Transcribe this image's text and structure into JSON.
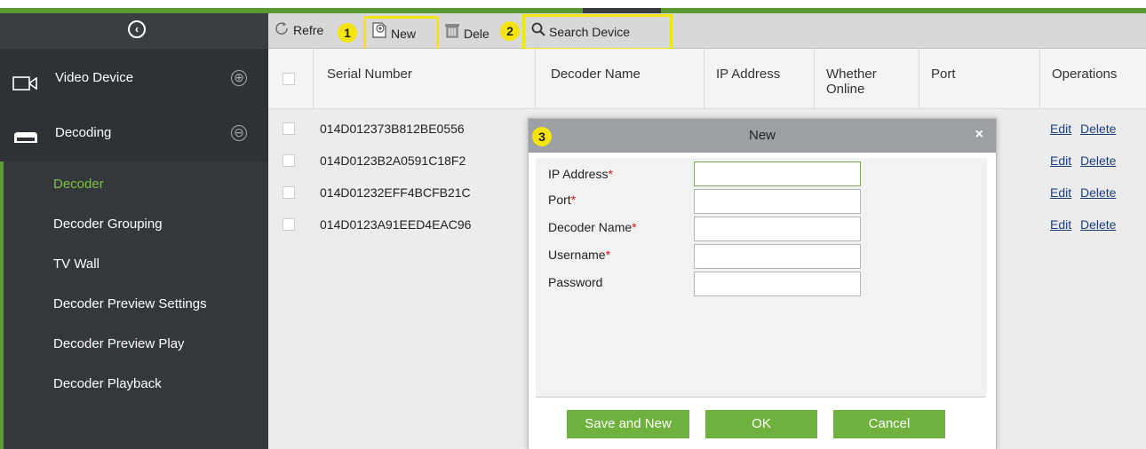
{
  "sidebar": {
    "collapse_icon": "chevron-left-circle-icon",
    "groups": [
      {
        "label": "Video Device",
        "icon": "camera-icon",
        "toggle": "⊕"
      },
      {
        "label": "Decoding",
        "icon": "decoder-device-icon",
        "toggle": "⊖"
      }
    ],
    "items": [
      {
        "label": "Decoder",
        "active": true
      },
      {
        "label": "Decoder Grouping"
      },
      {
        "label": "TV Wall"
      },
      {
        "label": "Decoder Preview Settings"
      },
      {
        "label": "Decoder Preview Play"
      },
      {
        "label": "Decoder Playback"
      }
    ]
  },
  "toolbar": {
    "refresh_label": "Refre",
    "new_label": "New",
    "delete_label": "Dele",
    "search_label": "Search Device"
  },
  "callouts": [
    "1",
    "2",
    "3"
  ],
  "table": {
    "columns": [
      "Serial Number",
      "Decoder Name",
      "IP Address",
      "Whether Online",
      "Port",
      "Operations"
    ],
    "rows": [
      {
        "serial": "014D012373B812BE0556",
        "edit": "Edit",
        "delete": "Delete"
      },
      {
        "serial": "014D0123B2A0591C18F2",
        "edit": "Edit",
        "delete": "Delete"
      },
      {
        "serial": "014D01232EFF4BCFB21C",
        "edit": "Edit",
        "delete": "Delete"
      },
      {
        "serial": "014D0123A91EED4EAC96",
        "edit": "Edit",
        "delete": "Delete"
      }
    ]
  },
  "dialog": {
    "title": "New",
    "close": "×",
    "fields": [
      {
        "label": "IP Address",
        "required": "*",
        "value": ""
      },
      {
        "label": "Port",
        "required": "*",
        "value": ""
      },
      {
        "label": "Decoder Name",
        "required": "*",
        "value": ""
      },
      {
        "label": "Username",
        "required": "*",
        "value": ""
      },
      {
        "label": "Password",
        "required": "",
        "value": ""
      }
    ],
    "buttons": {
      "save_new": "Save and New",
      "ok": "OK",
      "cancel": "Cancel"
    }
  },
  "colors": {
    "accent": "#6fb13f",
    "sidebar": "#2e3135",
    "highlight": "#f5e40b"
  }
}
